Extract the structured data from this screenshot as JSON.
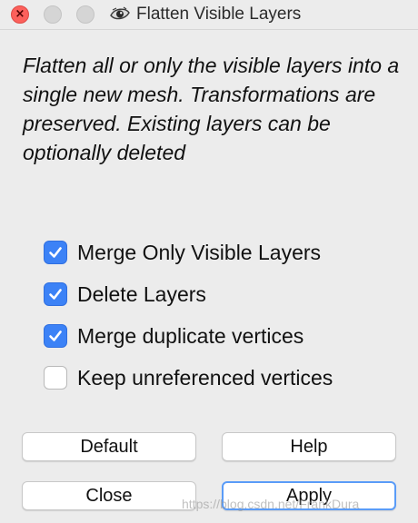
{
  "window": {
    "title": "Flatten Visible Layers",
    "title_icon": "meshlab-eye-icon"
  },
  "description": "Flatten all or only the visible layers into a single new mesh. Transformations are preserved. Existing layers can be optionally deleted",
  "options": [
    {
      "label": "Merge Only Visible Layers",
      "checked": true
    },
    {
      "label": "Delete Layers",
      "checked": true
    },
    {
      "label": "Merge duplicate vertices",
      "checked": true
    },
    {
      "label": "Keep unreferenced vertices",
      "checked": false
    }
  ],
  "buttons": {
    "default": "Default",
    "help": "Help",
    "close": "Close",
    "apply": "Apply"
  },
  "watermark": "https://blog.csdn.net/FrankDura",
  "colors": {
    "checkbox_checked": "#3c82f6",
    "close_light": "#fc605b",
    "apply_focus_ring": "#5a9cf8"
  }
}
